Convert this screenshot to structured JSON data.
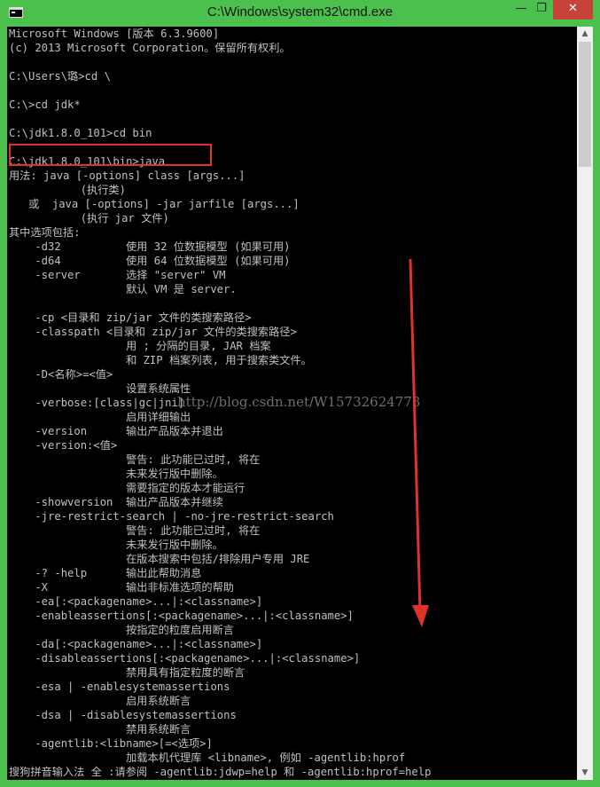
{
  "window": {
    "title": "C:\\Windows\\system32\\cmd.exe",
    "minimize_glyph": "—",
    "maximize_glyph": "❐",
    "close_glyph": "✕"
  },
  "console": {
    "lines": [
      "Microsoft Windows [版本 6.3.9600]",
      "(c) 2013 Microsoft Corporation。保留所有权利。",
      "",
      "C:\\Users\\璐>cd \\",
      "",
      "C:\\>cd jdk*",
      "",
      "C:\\jdk1.8.0_101>cd bin",
      "",
      "C:\\jdk1.8.0_101\\bin>java",
      "用法: java [-options] class [args...]",
      "           (执行类)",
      "   或  java [-options] -jar jarfile [args...]",
      "           (执行 jar 文件)",
      "其中选项包括:",
      "    -d32          使用 32 位数据模型 (如果可用)",
      "    -d64          使用 64 位数据模型 (如果可用)",
      "    -server       选择 \"server\" VM",
      "                  默认 VM 是 server.",
      "",
      "    -cp <目录和 zip/jar 文件的类搜索路径>",
      "    -classpath <目录和 zip/jar 文件的类搜索路径>",
      "                  用 ; 分隔的目录, JAR 档案",
      "                  和 ZIP 档案列表, 用于搜索类文件。",
      "    -D<名称>=<值>",
      "                  设置系统属性",
      "    -verbose:[class|gc|jni]",
      "                  启用详细输出",
      "    -version      输出产品版本并退出",
      "    -version:<值>",
      "                  警告: 此功能已过时, 将在",
      "                  未来发行版中删除。",
      "                  需要指定的版本才能运行",
      "    -showversion  输出产品版本并继续",
      "    -jre-restrict-search | -no-jre-restrict-search",
      "                  警告: 此功能已过时, 将在",
      "                  未来发行版中删除。",
      "                  在版本搜索中包括/排除用户专用 JRE",
      "    -? -help      输出此帮助消息",
      "    -X            输出非标准选项的帮助",
      "    -ea[:<packagename>...|:<classname>]",
      "    -enableassertions[:<packagename>...|:<classname>]",
      "                  按指定的粒度启用断言",
      "    -da[:<packagename>...|:<classname>]",
      "    -disableassertions[:<packagename>...|:<classname>]",
      "                  禁用具有指定粒度的断言",
      "    -esa | -enablesystemassertions",
      "                  启用系统断言",
      "    -dsa | -disablesystemassertions",
      "                  禁用系统断言",
      "    -agentlib:<libname>[=<选项>]",
      "                  加载本机代理库 <libname>, 例如 -agentlib:hprof",
      "搜狗拼音输入法 全 :请参阅 -agentlib:jdwp=help 和 -agentlib:hprof=help"
    ]
  },
  "watermark": "http://blog.csdn.net/W15732624773",
  "annotation": {
    "highlight_color": "#e0312a",
    "arrow_color": "#e0312a"
  },
  "scrollbar": {
    "up_glyph": "▲",
    "down_glyph": "▼"
  }
}
